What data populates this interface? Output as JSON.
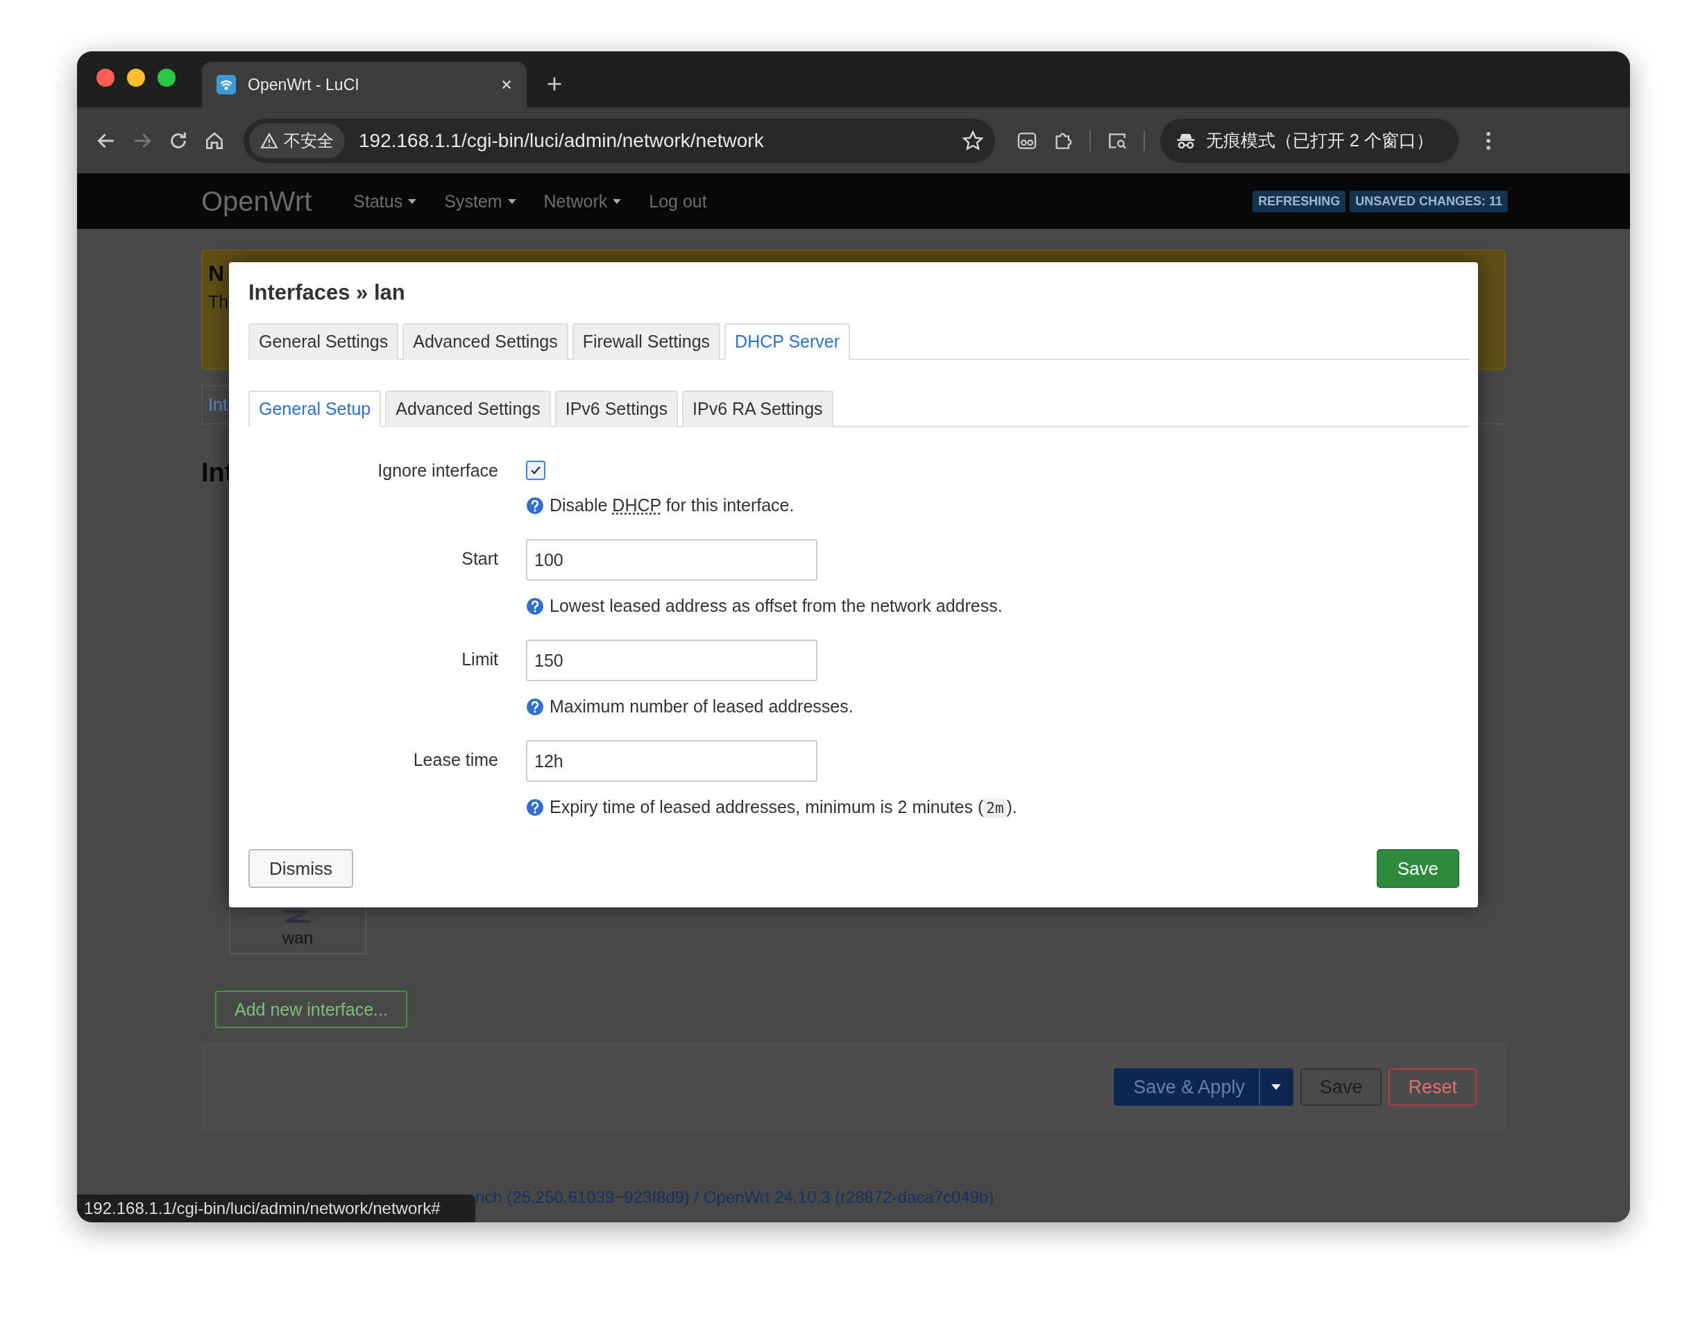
{
  "browser": {
    "tab_title": "OpenWrt - LuCI",
    "security_label": "不安全",
    "url": "192.168.1.1/cgi-bin/luci/admin/network/network",
    "incognito_label": "无痕模式（已打开 2 个窗口）"
  },
  "navbar": {
    "brand": "OpenWrt",
    "menu": [
      {
        "label": "Status",
        "dropdown": true
      },
      {
        "label": "System",
        "dropdown": true
      },
      {
        "label": "Network",
        "dropdown": true
      },
      {
        "label": "Log out",
        "dropdown": false
      }
    ],
    "badges": [
      "REFRESHING",
      "UNSAVED CHANGES: 11"
    ]
  },
  "background_page": {
    "notice_title": "N",
    "notice_text": "Th",
    "tab": "Int",
    "heading": "Int",
    "interface": "wan",
    "add_button": "Add new interface...",
    "actions": [
      {
        "label": "Save & Apply",
        "kind": "primary"
      },
      {
        "label": "Save",
        "kind": "neutral"
      },
      {
        "label": "Reset",
        "kind": "danger"
      }
    ]
  },
  "modal": {
    "title": "Interfaces » lan",
    "tabs": [
      {
        "label": "General Settings",
        "selected": false
      },
      {
        "label": "Advanced Settings",
        "selected": false
      },
      {
        "label": "Firewall Settings",
        "selected": false
      },
      {
        "label": "DHCP Server",
        "selected": true
      }
    ],
    "subtabs": [
      {
        "label": "General Setup",
        "selected": true
      },
      {
        "label": "Advanced Settings",
        "selected": false
      },
      {
        "label": "IPv6 Settings",
        "selected": false
      },
      {
        "label": "IPv6 RA Settings",
        "selected": false
      }
    ],
    "fields": [
      {
        "label": "Ignore interface",
        "kind": "checkbox",
        "checked": true,
        "help": [
          {
            "kind": "text",
            "text": "Disable "
          },
          {
            "kind": "abbr",
            "text": "DHCP"
          },
          {
            "kind": "text",
            "text": " for this interface."
          }
        ]
      },
      {
        "label": "Start",
        "kind": "text",
        "value": "100",
        "help": [
          {
            "kind": "text",
            "text": "Lowest leased address as offset from the network address."
          }
        ]
      },
      {
        "label": "Limit",
        "kind": "text",
        "value": "150",
        "help": [
          {
            "kind": "text",
            "text": "Maximum number of leased addresses."
          }
        ]
      },
      {
        "label": "Lease time",
        "kind": "text",
        "value": "12h",
        "help": [
          {
            "kind": "text",
            "text": "Expiry time of leased addresses, minimum is 2 minutes ("
          },
          {
            "kind": "code",
            "text": "2m"
          },
          {
            "kind": "text",
            "text": ")."
          }
        ]
      }
    ],
    "dismiss_button": "Dismiss",
    "save_button": "Save"
  },
  "footer": {
    "text": "nch (25.250.61039~923f8d9) / OpenWrt 24.10.3 (r28872-daca7c049b)"
  },
  "status_tooltip": "192.168.1.1/cgi-bin/luci/admin/network/network#"
}
